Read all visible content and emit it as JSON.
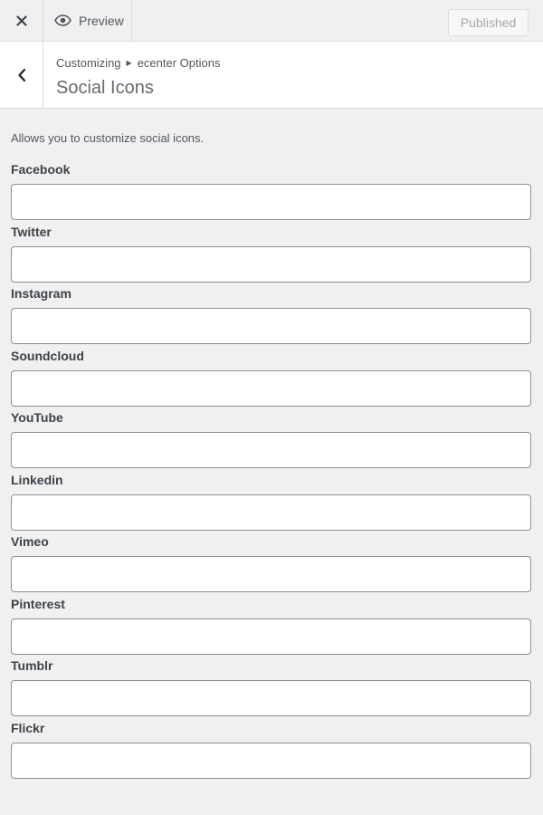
{
  "topbar": {
    "close_icon": "close-icon",
    "preview_label": "Preview",
    "preview_icon": "eye-icon",
    "published_label": "Published"
  },
  "header": {
    "back_icon": "chevron-left-icon",
    "breadcrumb": [
      "Customizing",
      "ecenter Options"
    ],
    "breadcrumb_separator_icon": "triangle-right-icon",
    "title": "Social Icons"
  },
  "section": {
    "description": "Allows you to customize social icons."
  },
  "fields": [
    {
      "label": "Facebook",
      "value": "",
      "placeholder": ""
    },
    {
      "label": "Twitter",
      "value": "",
      "placeholder": ""
    },
    {
      "label": "Instagram",
      "value": "",
      "placeholder": ""
    },
    {
      "label": "Soundcloud",
      "value": "",
      "placeholder": ""
    },
    {
      "label": "YouTube",
      "value": "",
      "placeholder": ""
    },
    {
      "label": "Linkedin",
      "value": "",
      "placeholder": ""
    },
    {
      "label": "Vimeo",
      "value": "",
      "placeholder": ""
    },
    {
      "label": "Pinterest",
      "value": "",
      "placeholder": ""
    },
    {
      "label": "Tumblr",
      "value": "",
      "placeholder": ""
    },
    {
      "label": "Flickr",
      "value": "",
      "placeholder": ""
    }
  ]
}
